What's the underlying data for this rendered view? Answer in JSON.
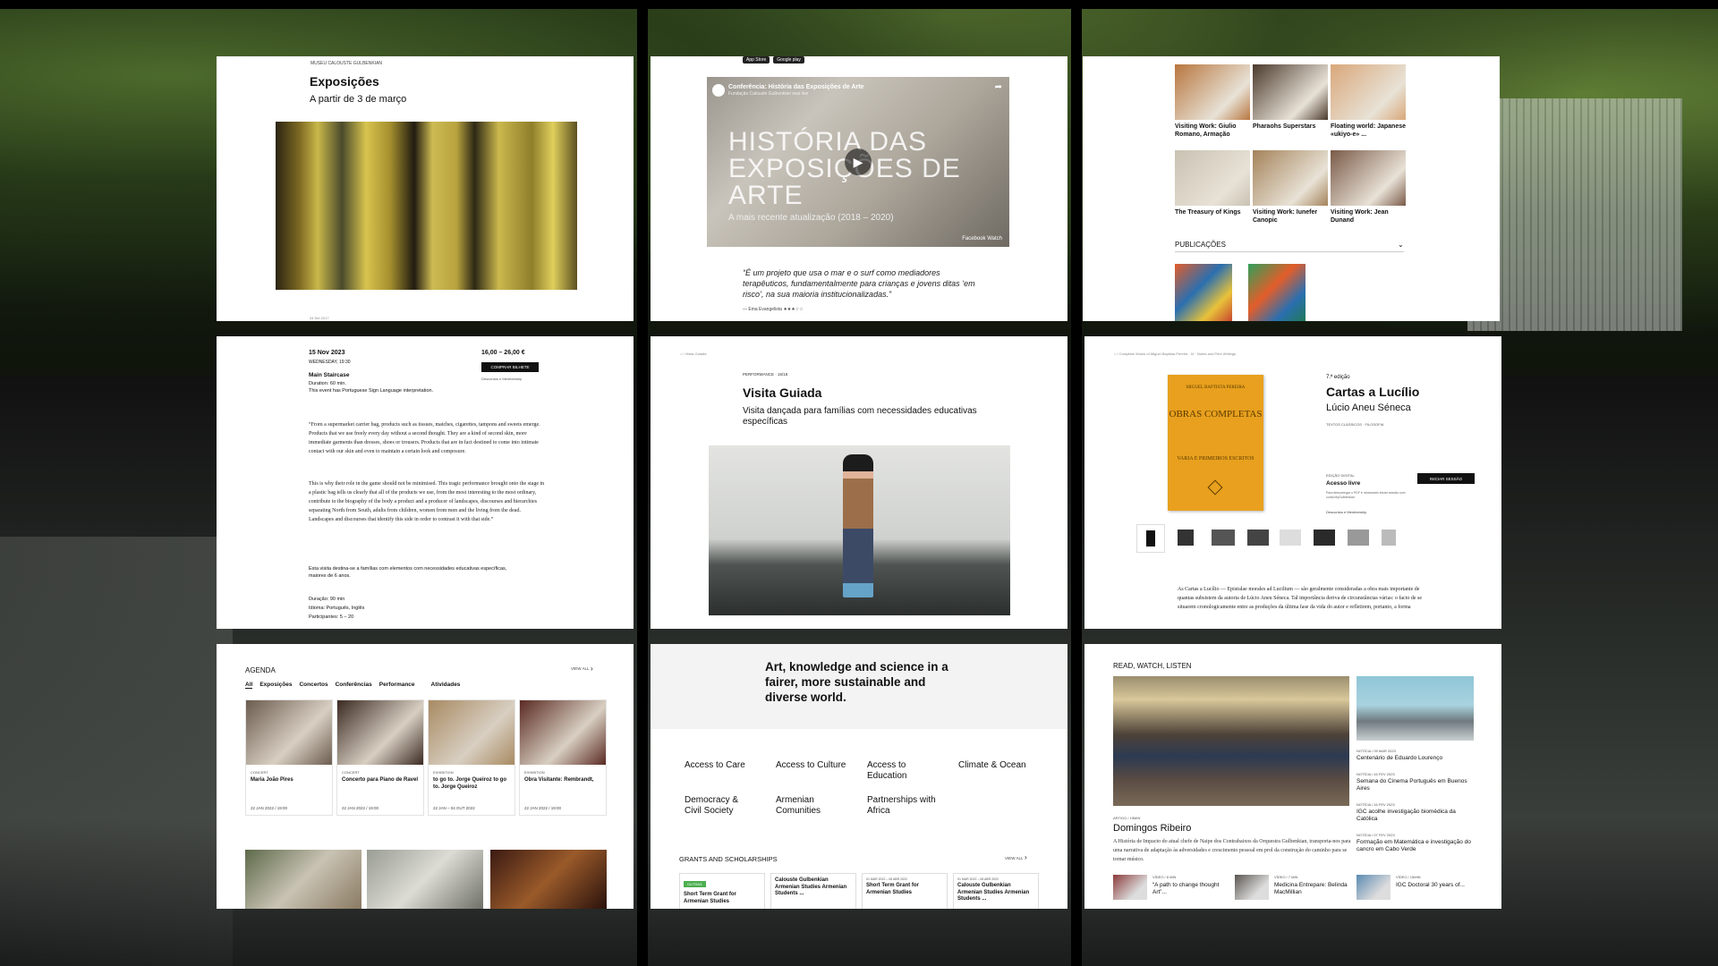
{
  "panel1": {
    "brand": "MUSEU CALOUSTE GULBENKIAN",
    "title": "Exposições",
    "subtitle": "A partir de 3 de março",
    "footer": "04 Set 2017"
  },
  "panel2": {
    "stores": [
      "App Store",
      "Google play"
    ],
    "video_title": "Conferência: História das Exposições de Arte",
    "video_sub": "Fundação Calouste Gulbenkian was live",
    "video_big": "HISTÓRIA DAS EXPOSIÇÕES DE ARTE",
    "video_update": "A mais recente atualização (2018 – 2020)",
    "watch_label": "Facebook Watch",
    "quote": "“É um projeto que usa o mar e o surf como mediadores terapêuticos, fundamentalmente para crianças e jovens ditas ‘em risco’, na sua maioria institucionalizadas.”",
    "quote_author": "— Ema Evangelista"
  },
  "panel3": {
    "tiles": [
      {
        "label": "Visiting Work: Giulio Romano, Armação",
        "color": "#b8763f"
      },
      {
        "label": "Pharaohs Superstars",
        "color": "#4a3a2c"
      },
      {
        "label": "Floating world: Japanese «ukiyo-e» ...",
        "color": "#d9a77a"
      },
      {
        "label": "The Treasury of Kings",
        "color": "#c9c2b3"
      },
      {
        "label": "Visiting Work: Iunefer Canopic",
        "color": "#a4835a"
      },
      {
        "label": "Visiting Work: Jean Dunand",
        "color": "#7a5a48"
      }
    ],
    "publications_label": "PUBLICAÇÕES"
  },
  "panel4": {
    "date": "15 Nov 2023",
    "weekday": "WEDNESDAY, 19:30",
    "price": "16,00 – 26,00 €",
    "buy_label": "COMPRAR BILHETE",
    "discounts": "Descontos e Membership",
    "venue": "Main Staircase",
    "duration": "Duration: 60 min.",
    "sign_note": "This event has Portuguese Sign Language interpretation.",
    "para1": "“From a supermarket carrier bag, products such as tissues, matches, cigarettes, tampons and sweets emerge. Products that we use freely every day without a second thought. They are a kind of second skin, more immediate garments than dresses, shoes or trousers. Products that are in fact destined to come into intimate contact with our skin and even to maintain a certain look and composure.",
    "para2": "This is why their role in the game should not be minimised. This tragic performance brought onto the stage in a plastic bag tells us clearly that all of the products we use, from the most interesting to the most ordinary, contribute to the biography of the body a product and a producer of landscapes, discourses and hierarchies separating North from South, adults from children, women from men and the living from the dead. Landscapes and discourses that identify this side in order to contrast it with that side.”",
    "para3": "Esta visita destina-se a famílias com elementos com necessidades educativas específicas, maiores de 6 anos.",
    "info1": "Duração: 90 min",
    "info2": "Idioma: Português, Inglês",
    "info3": "Participantes: 5 – 20"
  },
  "panel5": {
    "crumb": "Visita Guiada",
    "category": "PERFORMANCE · 16/18",
    "title": "Visita Guiada",
    "subtitle": "Visita dançada para famílias com necessidades educativas específicas"
  },
  "panel6": {
    "crumb": "Complete Works of Miguel Baptista Pereira · IV · Notes and Print Writings",
    "cover_author": "MIGUEL BAPTISTA PEREIRA",
    "cover_title": "OBRAS COMPLETAS",
    "cover_vol": "VARIA E PRIMEIROS ESCRITOS",
    "edition": "7.ª edição",
    "title": "Cartas a Lucílio",
    "author": "Lúcio Aneu Séneca",
    "tags": "TEXTOS CLÁSSICOS · FILOSOFIA",
    "digital_label": "EDIÇÃO DIGITAL",
    "access": "Acesso livre",
    "login_label": "INICIAR SESSÃO",
    "hint": "Para descarregar o PDF é necessário iniciar sessão com conta MyGulbenkian.",
    "membership": "Descontos e Membership",
    "desc": "As Cartas a Lucílio — Epistulae morales ad Lucilium — são geralmente consideradas a obra mais importante de quantas subsistem da autoria de Lúcio Aneu Séneca. Tal importância deriva de circunstâncias várias: o facto de se situarem cronologicamente entre as produções da última fase da vida do autor e refletirem, portanto, a forma"
  },
  "panel7": {
    "agenda": "AGENDA",
    "view_all": "VIEW ALL",
    "tabs": [
      "All",
      "Exposições",
      "Concertos",
      "Conferências",
      "Performance",
      "Atividades"
    ],
    "cards": [
      {
        "kind": "CONCERT",
        "title": "Maria João Pires",
        "date": "22 JAN 2022 / 19:00",
        "color": "#6b5c4f"
      },
      {
        "kind": "CONCERT",
        "title": "Concerto para Piano de Ravel",
        "date": "22 JAN 2022 / 19:00",
        "color": "#3b2a22"
      },
      {
        "kind": "EXHIBITION",
        "title": "to go to. Jorge Queiroz to go to. Jorge Queiroz",
        "date": "22 JAN – 04 OUT 2022",
        "color": "#a88a62"
      },
      {
        "kind": "EXHIBITION",
        "title": "Obra Visitante: Rembrandt,",
        "date": "22 JAN 2022 / 19:00",
        "color": "#5a2a22"
      }
    ]
  },
  "panel8": {
    "mission": "Art, knowledge and science in a fairer, more sustainable and diverse world.",
    "causes": [
      "Access to Care",
      "Access to Culture",
      "Access to Education",
      "Climate & Ocean",
      "Democracy & Civil Society",
      "Armenian Comunities",
      "Partnerships with Africa"
    ],
    "grants_label": "GRANTS AND SCHOLARSHIPS",
    "view_all": "VIEW ALL",
    "badge": "OUTRAS",
    "grants": [
      {
        "date": "",
        "title": "Short Term Grant for Armenian Studies"
      },
      {
        "date": "",
        "title": "Calouste Gulbenkian Armenian Studies Armenian Students ..."
      },
      {
        "date": "01 MAR 2022 – 08 ABR 2022",
        "title": "Short Term Grant for Armenian Studies"
      },
      {
        "date": "01 MAR 2022 – 08 ABR 2022",
        "title": "Calouste Gulbenkian Armenian Studies Armenian Students ..."
      }
    ]
  },
  "panel9": {
    "heading": "READ, WATCH, LISTEN",
    "main_kind": "ARTIGO / 15MIN",
    "main_title": "Domingos Ribeiro",
    "main_text": "A História de Impacto do atual chefe de Naipe dos Contrabaixos da Orquestra Gulbenkian, transporta-nos para uma narrativa de adaptação às adversidades e crescimento pessoal em prol da construção do caminho para se tornar músico.",
    "news": [
      {
        "kind": "NOTÍCIA / 09 MAR 2023",
        "title": "Centenário de Eduardo Lourenço"
      },
      {
        "kind": "NOTÍCIA / 16 FEV 2023",
        "title": "Semana do Cinema Português em Buenos Aires"
      },
      {
        "kind": "NOTÍCIA / 16 FEV 2023",
        "title": "IGC acolhe investigação biomédica da Católica"
      },
      {
        "kind": "NOTÍCIA / 07 FEV 2023",
        "title": "Formação em Matemática e investigação do cancro em Cabo Verde"
      }
    ],
    "videos": [
      {
        "kind": "VÍDEO / 8 MIN",
        "title": "“A path to change thought Art”...",
        "color": "#8a3a3a"
      },
      {
        "kind": "VÍDEO / 7 MIN",
        "title": "Medicina Entrepare: Belinda MacMillian",
        "color": "#5a5550"
      },
      {
        "kind": "VÍDEO / 15MIN",
        "title": "IGC Doctoral 30 years of...",
        "color": "#5a8ab0"
      }
    ]
  }
}
